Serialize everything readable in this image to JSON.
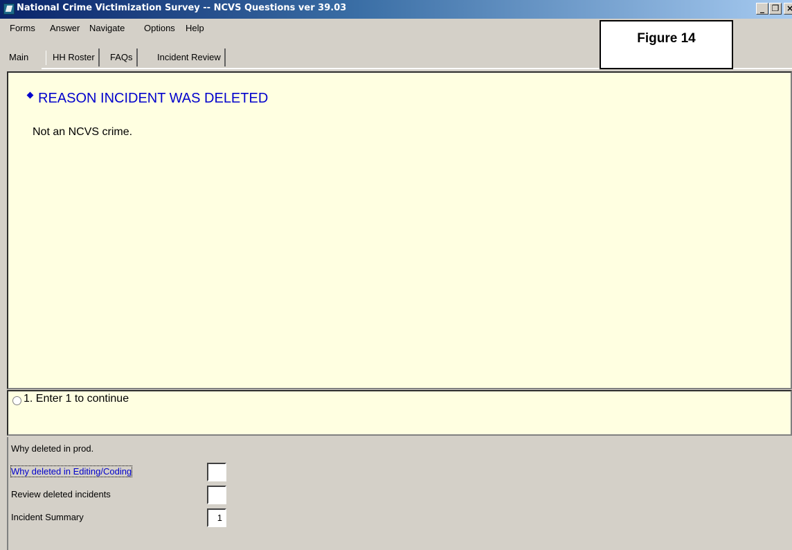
{
  "window": {
    "title": "National Crime Victimization Survey -- NCVS Questions ver 39.03",
    "minimize_glyph": "_",
    "maximize_glyph": "ʘ",
    "close_glyph": "X"
  },
  "menu": [
    "Forms",
    "Answer",
    "Navigate",
    "Options",
    "Help"
  ],
  "tabs": [
    "Main",
    "HH Roster",
    "FAQs",
    "Incident Review"
  ],
  "question": {
    "heading": "REASON INCIDENT WAS DELETED",
    "body": "Not an NCVS crime."
  },
  "answer": {
    "option": "1.  Enter 1 to continue"
  },
  "fields": [
    {
      "label": "Why deleted in prod.",
      "value": ""
    },
    {
      "label": "Why deleted in Editing/Coding",
      "value": ""
    },
    {
      "label": "Review deleted incidents",
      "value": ""
    },
    {
      "label": "Incident Summary",
      "value": "1"
    }
  ],
  "annotation": {
    "figure_label": "Figure 14"
  },
  "colors": {
    "question_bg": "#ffffe1",
    "heading_blue": "#0000cc",
    "window_bg": "#d4d0c8"
  }
}
